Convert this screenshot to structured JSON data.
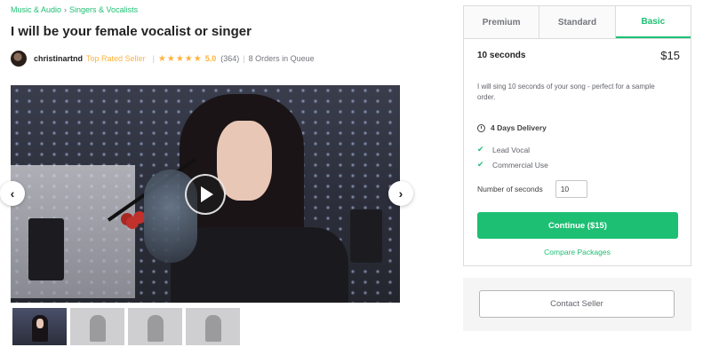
{
  "breadcrumb": {
    "items": [
      "Music & Audio",
      "Singers & Vocalists"
    ],
    "separator": "›"
  },
  "gig": {
    "title": "I will be your female vocalist or singer"
  },
  "seller": {
    "name": "christinartnd",
    "badge": "Top Rated Seller",
    "stars": "★★★★★",
    "rating": "5.0",
    "reviews": "(364)",
    "queue": "8 Orders in Queue"
  },
  "media": {
    "prev_icon": "chevron-left-icon",
    "next_icon": "chevron-right-icon",
    "play_icon": "play-icon",
    "prev_glyph": "‹",
    "next_glyph": "›",
    "thumbnail_count": 4,
    "active_thumbnail": 1
  },
  "packages": {
    "tabs": [
      "Premium",
      "Standard",
      "Basic"
    ],
    "active_tab": "Basic",
    "name": "10 seconds",
    "price": "$15",
    "description": "I will sing 10 seconds of your song - perfect for a sample order.",
    "delivery": "4 Days Delivery",
    "features": [
      "Lead Vocal",
      "Commercial Use"
    ],
    "quantity_label": "Number of seconds",
    "quantity_value": "10",
    "continue_label": "Continue ($15)",
    "compare_label": "Compare Packages"
  },
  "contact": {
    "label": "Contact Seller"
  },
  "colors": {
    "accent": "#1dbf73",
    "star": "#ffb33e",
    "text": "#404145"
  }
}
